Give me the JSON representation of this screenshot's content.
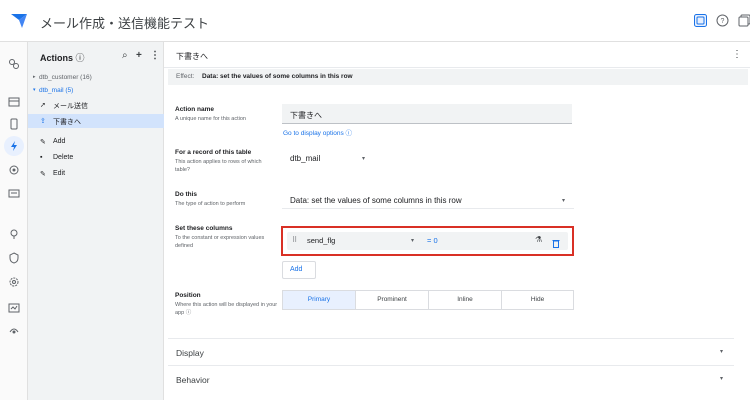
{
  "app": {
    "title": "メール作成・送信機能テスト"
  },
  "colors": {
    "accent": "#1a73e8",
    "highlight_border": "#d93025",
    "selected_bg": "#d2e3fc"
  },
  "panel": {
    "title": "Actions",
    "tables": [
      {
        "label": "dtb_customer (16)",
        "expanded": false
      },
      {
        "label": "dtb_mail (5)",
        "expanded": true
      }
    ],
    "actions": [
      {
        "icon": "send-icon",
        "glyph": "➚",
        "label": "メール送信",
        "selected": false
      },
      {
        "icon": "upload-icon",
        "glyph": "⇪",
        "label": "下書きへ",
        "selected": true
      },
      {
        "icon": "pencil-icon",
        "glyph": "✎",
        "label": "Add",
        "selected": false
      },
      {
        "icon": "trash-icon",
        "glyph": "▪",
        "label": "Delete",
        "selected": false
      },
      {
        "icon": "edit-icon",
        "glyph": "✎",
        "label": "Edit",
        "selected": false
      }
    ]
  },
  "main": {
    "title": "下書きへ",
    "effect_label": "Effect:",
    "effect_value": "Data: set the values of some columns in this row",
    "action_name": {
      "label": "Action name",
      "help": "A unique name for this action",
      "value": "下書きへ",
      "link": "Go to display options"
    },
    "record_table": {
      "label": "For a record of this table",
      "help": "This action applies to rows of which table?",
      "value": "dtb_mail"
    },
    "do_this": {
      "label": "Do this",
      "help": "The type of action to perform",
      "value": "Data: set the values of some columns in this row"
    },
    "set_columns": {
      "label": "Set these columns",
      "help": "To the constant or expression values defined",
      "column": "send_flg",
      "expression": "= 0",
      "add_label": "Add"
    },
    "position": {
      "label": "Position",
      "help": "Where this action will be displayed in your app",
      "options": [
        "Primary",
        "Prominent",
        "Inline",
        "Hide"
      ],
      "selected": "Primary"
    },
    "sections": [
      "Display",
      "Behavior"
    ]
  }
}
